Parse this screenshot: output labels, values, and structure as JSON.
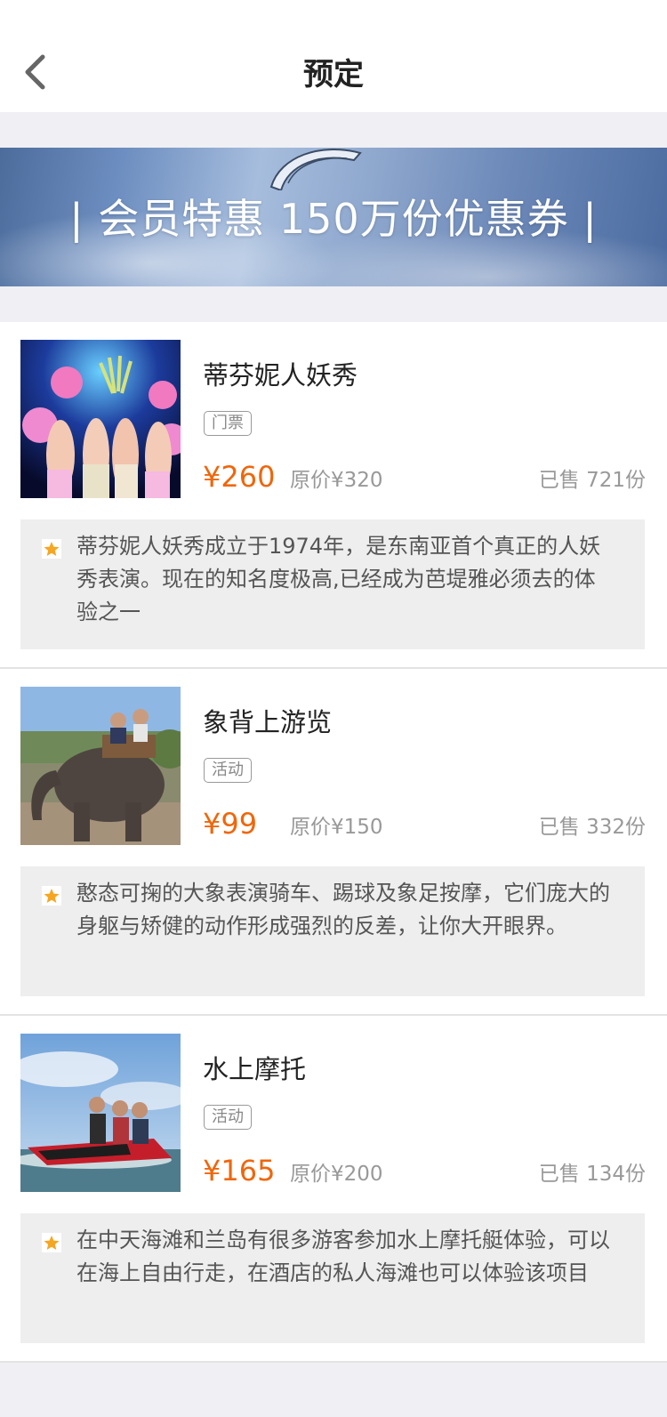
{
  "header": {
    "title": "预定",
    "back_icon": "chevron-left-icon"
  },
  "banner": {
    "text": "| 会员特惠 150万份优惠券 |"
  },
  "colors": {
    "price": "#f0660a",
    "star": "#f5a623",
    "background": "#efeff4"
  },
  "items": [
    {
      "title": "蒂芬妮人妖秀",
      "tag": "门票",
      "price": "¥260",
      "original_price": "原价¥320",
      "sold": "已售 721份",
      "description": "蒂芬妮人妖秀成立于1974年，是东南亚首个真正的人妖秀表演。现在的知名度极高,已经成为芭堤雅必须去的体验之一"
    },
    {
      "title": "象背上游览",
      "tag": "活动",
      "price": "¥99",
      "original_price": "原价¥150",
      "sold": "已售 332份",
      "description": "憨态可掬的大象表演骑车、踢球及象足按摩，它们庞大的身躯与矫健的动作形成强烈的反差，让你大开眼界。"
    },
    {
      "title": "水上摩托",
      "tag": "活动",
      "price": "¥165",
      "original_price": "原价¥200",
      "sold": "已售 134份",
      "description": "在中天海滩和兰岛有很多游客参加水上摩托艇体验，可以在海上自由行走，在酒店的私人海滩也可以体验该项目"
    }
  ]
}
